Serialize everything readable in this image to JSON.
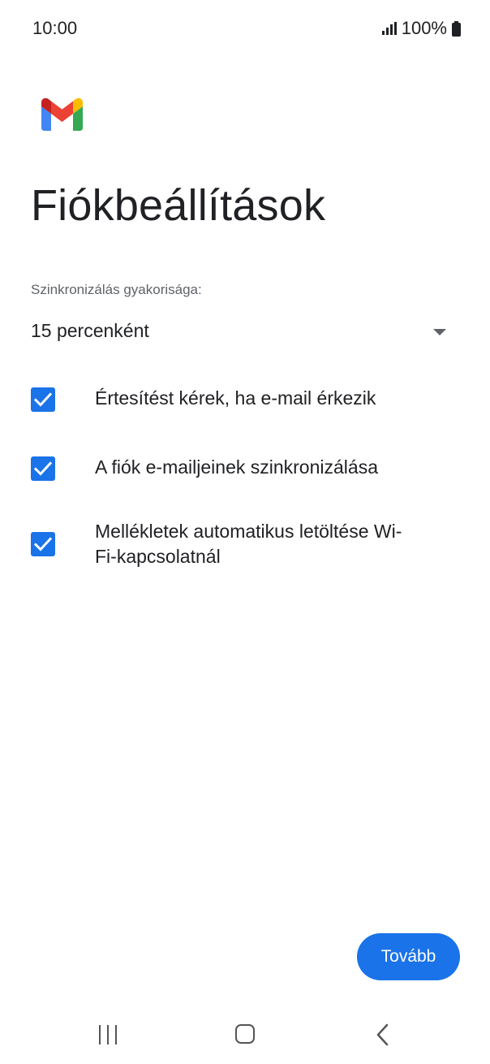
{
  "status_bar": {
    "time": "10:00",
    "battery": "100%",
    "signal_icon": "signal-bars-icon",
    "battery_icon": "battery-full-icon"
  },
  "header": {
    "logo_icon": "gmail-logo-icon",
    "title": "Fiókbeállítások"
  },
  "sync": {
    "label": "Szinkronizálás gyakorisága:",
    "selected_value": "15 percenként"
  },
  "options": [
    {
      "label": "Értesítést kérek, ha e-mail érkezik",
      "checked": true
    },
    {
      "label": "A fiók e-mailjeinek szinkronizálása",
      "checked": true
    },
    {
      "label": "Mellékletek automatikus letöltése Wi-Fi-kapcsolatnál",
      "checked": true
    }
  ],
  "footer": {
    "next_label": "Tovább"
  },
  "nav": {
    "recents_icon": "recents-icon",
    "home_icon": "home-icon",
    "back_icon": "back-icon"
  },
  "colors": {
    "accent": "#1a73e8",
    "text": "#202124",
    "secondary_text": "#5f6368"
  }
}
